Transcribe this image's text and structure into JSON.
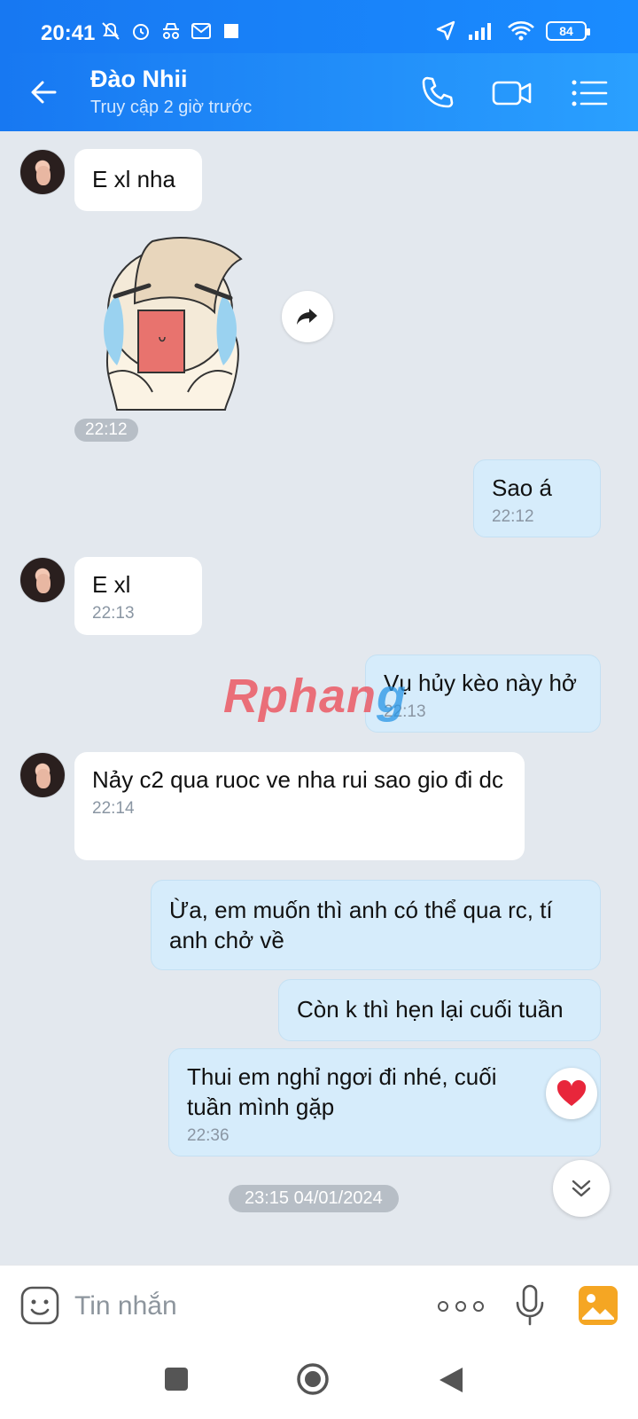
{
  "status_bar": {
    "time": "20:41",
    "battery": "84",
    "left_icons": [
      "mute-icon",
      "alarm-icon",
      "incognito-icon",
      "mail-icon",
      "square-icon"
    ],
    "right_icons": [
      "location-icon",
      "signal-icon",
      "wifi-icon",
      "battery-icon"
    ]
  },
  "header": {
    "contact_name": "Đào Nhii",
    "contact_status": "Truy cập 2 giờ trước",
    "icons": [
      "back-arrow-icon",
      "phone-icon",
      "video-call-icon",
      "menu-icon"
    ],
    "accent": "#1a8cff"
  },
  "messages": [
    {
      "direction": "in",
      "text": "E xl nha",
      "time": ""
    },
    {
      "direction": "in",
      "type": "sticker",
      "time": "22:12"
    },
    {
      "direction": "out",
      "text": "Sao á",
      "time": "22:12"
    },
    {
      "direction": "in",
      "text": "E xl",
      "time": "22:13"
    },
    {
      "direction": "out",
      "text": "Vụ hủy kèo này hở",
      "time": "22:13"
    },
    {
      "direction": "in",
      "text": "Nảy c2 qua ruoc ve nha rui sao gio đi dc",
      "time": "22:14"
    },
    {
      "direction": "out",
      "text": "Ừa, em muốn thì anh có thể qua rc, tí anh chở về",
      "time": ""
    },
    {
      "direction": "out",
      "text": "Còn k thì hẹn lại cuối tuần",
      "time": ""
    },
    {
      "direction": "out",
      "text": "Thui em nghỉ ngơi đi nhé, cuối tuần mình gặp",
      "time": "22:36"
    }
  ],
  "date_separator": "23:15 04/01/2024",
  "watermark": {
    "part1": "Rphan",
    "part2": "g"
  },
  "input": {
    "placeholder": "Tin nhắn",
    "value": ""
  },
  "reaction": "heart-icon",
  "colors": {
    "outgoing_bubble": "#d6ecfb",
    "incoming_bubble": "#ffffff",
    "chat_bg": "#e3e8ee"
  }
}
